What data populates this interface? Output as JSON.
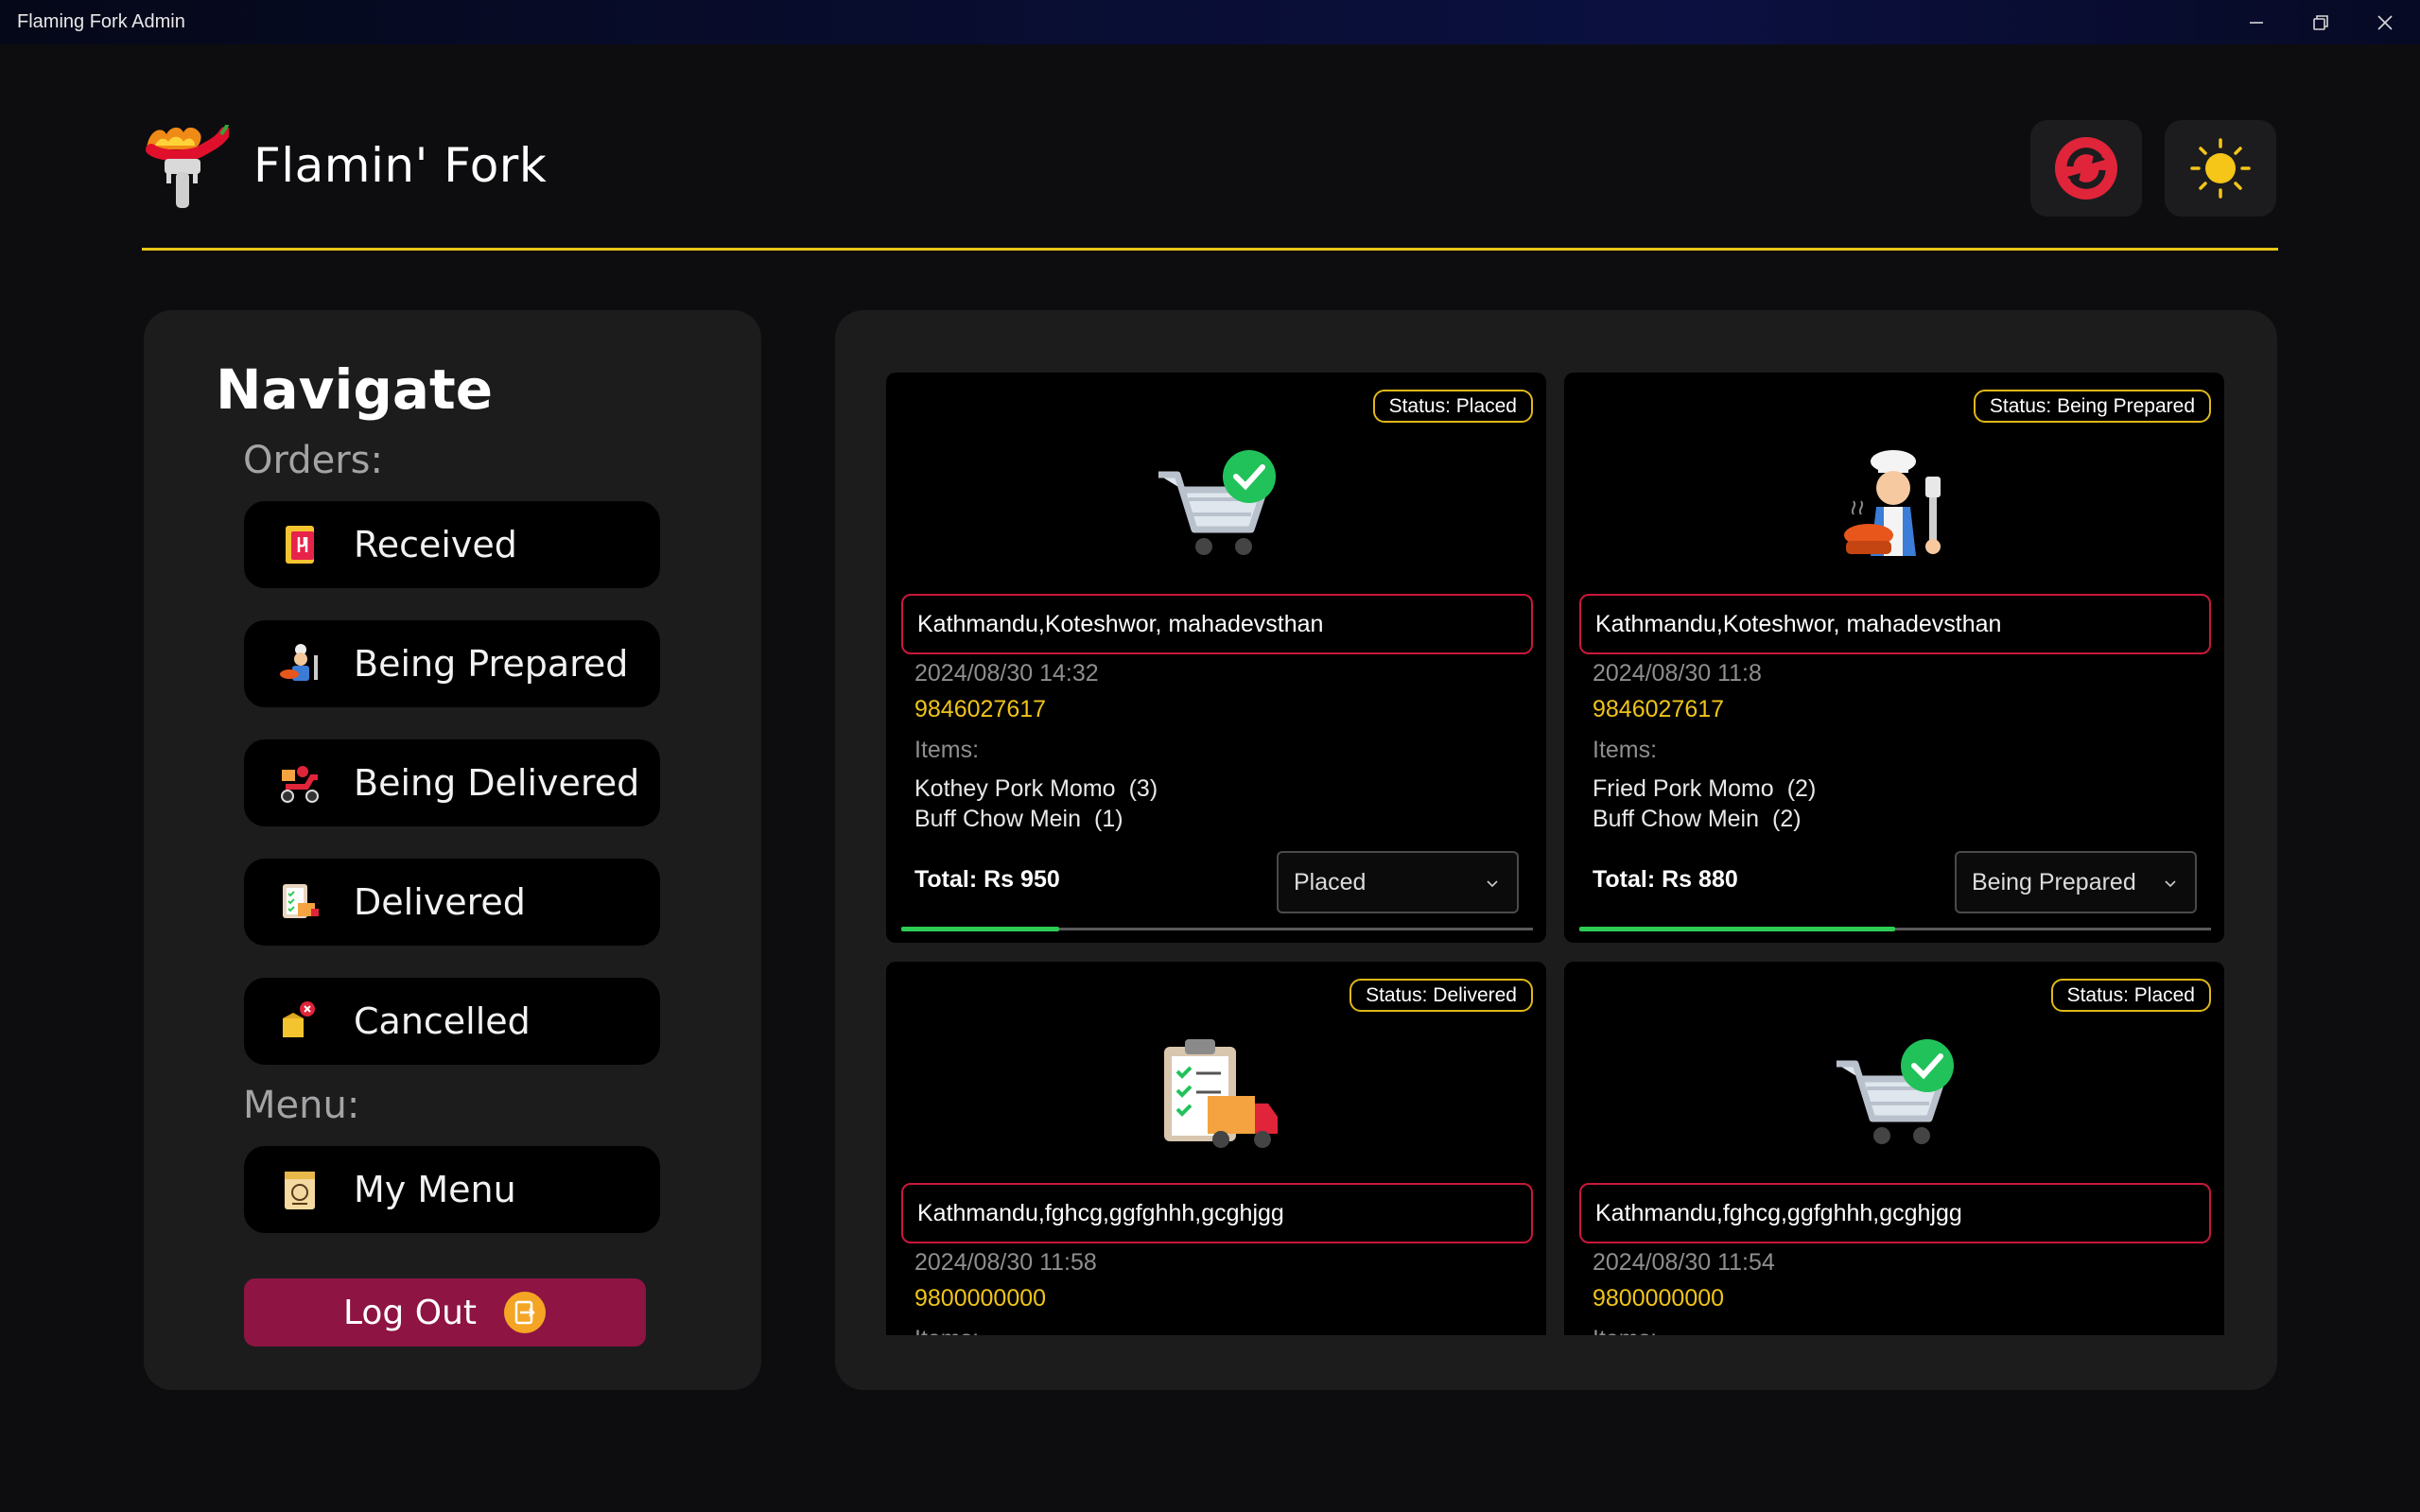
{
  "window": {
    "title": "Flaming Fork Admin"
  },
  "brand": {
    "name": "Flamin' Fork"
  },
  "sidebar": {
    "title": "Navigate",
    "orders_label": "Orders:",
    "menu_label": "Menu:",
    "items": [
      {
        "label": "Received",
        "icon": "received-order-icon"
      },
      {
        "label": "Being Prepared",
        "icon": "chef-icon"
      },
      {
        "label": "Being Delivered",
        "icon": "delivery-scooter-icon"
      },
      {
        "label": "Delivered",
        "icon": "delivered-clipboard-icon"
      },
      {
        "label": "Cancelled",
        "icon": "cancelled-box-icon"
      }
    ],
    "menu_item": {
      "label": "My Menu",
      "icon": "menu-card-icon"
    },
    "logout": {
      "label": "Log Out",
      "icon": "logout-icon"
    }
  },
  "colors": {
    "accent_yellow": "#e8c417",
    "address_border": "#c8183a",
    "logout": "#8e1443",
    "progress": "#2ecc55",
    "phone": "#f0c419"
  },
  "orders": [
    {
      "status": "Status: Placed",
      "illustration": "cart-check-icon",
      "address": "Kathmandu,Koteshwor, mahadevsthan",
      "date": "2024/08/30 14:32",
      "phone": "9846027617",
      "items_label": "Items:",
      "items": [
        {
          "name": "Kothey Pork Momo",
          "qty": "(3)"
        },
        {
          "name": "Buff Chow Mein",
          "qty": "(1)"
        }
      ],
      "total": "Total: Rs 950",
      "select_value": "Placed",
      "progress": 0.25
    },
    {
      "status": "Status: Being Prepared",
      "illustration": "chef-cooking-icon",
      "address": "Kathmandu,Koteshwor, mahadevsthan",
      "date": "2024/08/30 11:8",
      "phone": "9846027617",
      "items_label": "Items:",
      "items": [
        {
          "name": "Fried Pork Momo",
          "qty": "(2)"
        },
        {
          "name": "Buff Chow Mein",
          "qty": "(2)"
        }
      ],
      "total": "Total: Rs 880",
      "select_value": "Being Prepared",
      "progress": 0.5
    },
    {
      "status": "Status: Delivered",
      "illustration": "clipboard-truck-icon",
      "address": "Kathmandu,fghcg,ggfghhh,gcghjgg",
      "date": "2024/08/30 11:58",
      "phone": "9800000000",
      "items_label": "Items:"
    },
    {
      "status": "Status: Placed",
      "illustration": "cart-check-icon",
      "address": "Kathmandu,fghcg,ggfghhh,gcghjgg",
      "date": "2024/08/30 11:54",
      "phone": "9800000000",
      "items_label": "Items:"
    }
  ]
}
